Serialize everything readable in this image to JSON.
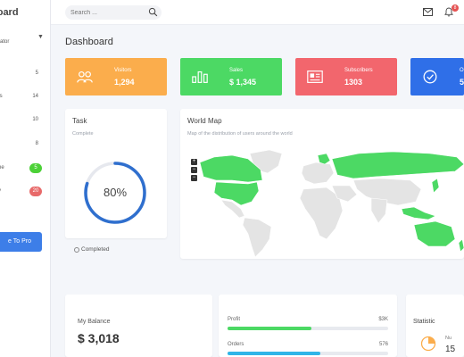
{
  "sidebar": {
    "brand": "board",
    "role": "rator",
    "items": [
      {
        "label": "",
        "count": "5"
      },
      {
        "label": "ts",
        "count": "14"
      },
      {
        "label": "",
        "count": "10"
      },
      {
        "label": "",
        "count": "8"
      },
      {
        "label": "ne",
        "count": "5",
        "badge_color": "#4cd137"
      },
      {
        "label": "y",
        "count": "20",
        "badge_color": "#e86a6a"
      }
    ],
    "upgrade_label": "e To Pro"
  },
  "topbar": {
    "search_placeholder": "Search ...",
    "notification_count": "8"
  },
  "page_title": "Dashboard",
  "stats": [
    {
      "label": "Visitors",
      "value": "1,294",
      "color": "#fbad4c",
      "icon": "users-icon"
    },
    {
      "label": "Sales",
      "value": "$ 1,345",
      "color": "#4cd964",
      "icon": "bar-chart-icon"
    },
    {
      "label": "Subscribers",
      "value": "1303",
      "color": "#f2666d",
      "icon": "newspaper-icon"
    },
    {
      "label": "O",
      "value": "5",
      "color": "#2f6fe8",
      "icon": "check-circle-icon"
    }
  ],
  "task": {
    "title": "Task",
    "subtitle": "Complete",
    "percent": 80,
    "percent_label": "80%",
    "status": "Completed"
  },
  "world_map": {
    "title": "World Map",
    "subtitle": "Map of the distribution of users around the world",
    "zoom_in": "+",
    "zoom_out": "−",
    "highlight_color": "#4cd964",
    "base_color": "#e4e4e4"
  },
  "balance": {
    "label": "My Balance",
    "value": "$ 3,018"
  },
  "progress": [
    {
      "label": "Profit",
      "value": "$3K",
      "fraction": 0.52,
      "color": "#4cd964"
    },
    {
      "label": "Orders",
      "value": "576",
      "fraction": 0.58,
      "color": "#2fb5e8"
    }
  ],
  "statistic": {
    "title": "Statistic",
    "label": "Nu",
    "value": "15"
  }
}
